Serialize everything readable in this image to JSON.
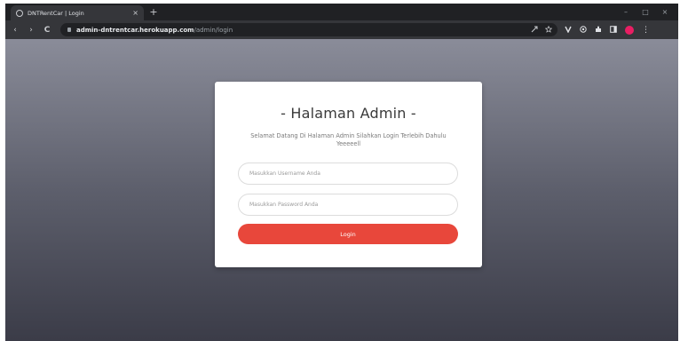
{
  "browser": {
    "tab": {
      "title": "DNTRentCar | Login",
      "close_glyph": "×",
      "favicon": "globe-icon"
    },
    "new_tab_glyph": "+",
    "window_controls": {
      "minimize": "–",
      "maximize": "□",
      "close": "×"
    },
    "nav": {
      "back": "‹",
      "forward": "›",
      "reload": "C"
    },
    "address": {
      "host": "admin-dntrentcar.herokuapp.com",
      "path": "/admin/login"
    },
    "omnibox_icons": [
      "share-icon",
      "star-icon"
    ],
    "extensions": [
      "v-extension-icon",
      "shield-extension-icon",
      "puzzle-icon",
      "sidebar-icon"
    ],
    "profile_color": "#e91e63",
    "menu_glyph": "⋮"
  },
  "page": {
    "title": "- Halaman Admin -",
    "subtitle": "Selamat Datang Di Halaman Admin Silahkan Login Terlebih Dahulu Yeeeeell",
    "username_placeholder": "Masukkan Username Anda",
    "password_placeholder": "Masukkan Password Anda",
    "login_label": "Login",
    "accent_color": "#e8473b"
  }
}
